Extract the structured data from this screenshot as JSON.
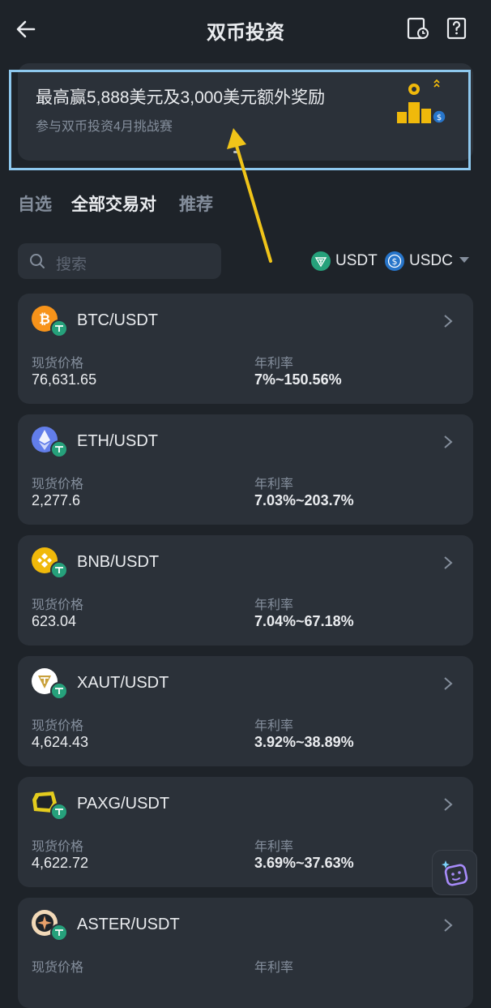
{
  "header": {
    "title": "双币投资"
  },
  "banner": {
    "title": "最高赢5,888美元及3,000美元额外奖励",
    "subtitle": "参与双币投资4月挑战赛"
  },
  "tabs": [
    {
      "label": "自选"
    },
    {
      "label": "全部交易对"
    },
    {
      "label": "推荐"
    }
  ],
  "search": {
    "placeholder": "搜索"
  },
  "coin_filter": [
    {
      "label": "USDT"
    },
    {
      "label": "USDC"
    }
  ],
  "pairs": [
    {
      "name": "BTC/USDT",
      "price_label": "现货价格",
      "price": "76,631.65",
      "apr_label": "年利率",
      "apr": "7%~150.56%"
    },
    {
      "name": "ETH/USDT",
      "price_label": "现货价格",
      "price": "2,277.6",
      "apr_label": "年利率",
      "apr": "7.03%~203.7%"
    },
    {
      "name": "BNB/USDT",
      "price_label": "现货价格",
      "price": "623.04",
      "apr_label": "年利率",
      "apr": "7.04%~67.18%"
    },
    {
      "name": "XAUT/USDT",
      "price_label": "现货价格",
      "price": "4,624.43",
      "apr_label": "年利率",
      "apr": "3.92%~38.89%"
    },
    {
      "name": "PAXG/USDT",
      "price_label": "现货价格",
      "price": "4,622.72",
      "apr_label": "年利率",
      "apr": "3.69%~37.63%"
    },
    {
      "name": "ASTER/USDT",
      "price_label": "现货价格",
      "price": "",
      "apr_label": "年利率",
      "apr": ""
    }
  ],
  "colors": {
    "background": "#1e2329",
    "card": "#2b3139",
    "text_primary": "#eaecef",
    "text_secondary": "#848e9c",
    "accent_yellow": "#f0b90b",
    "tether_green": "#26a17b",
    "usdc_blue": "#2775ca",
    "highlight_outline": "#8ec8ee",
    "annotation_arrow": "#f0c419"
  }
}
